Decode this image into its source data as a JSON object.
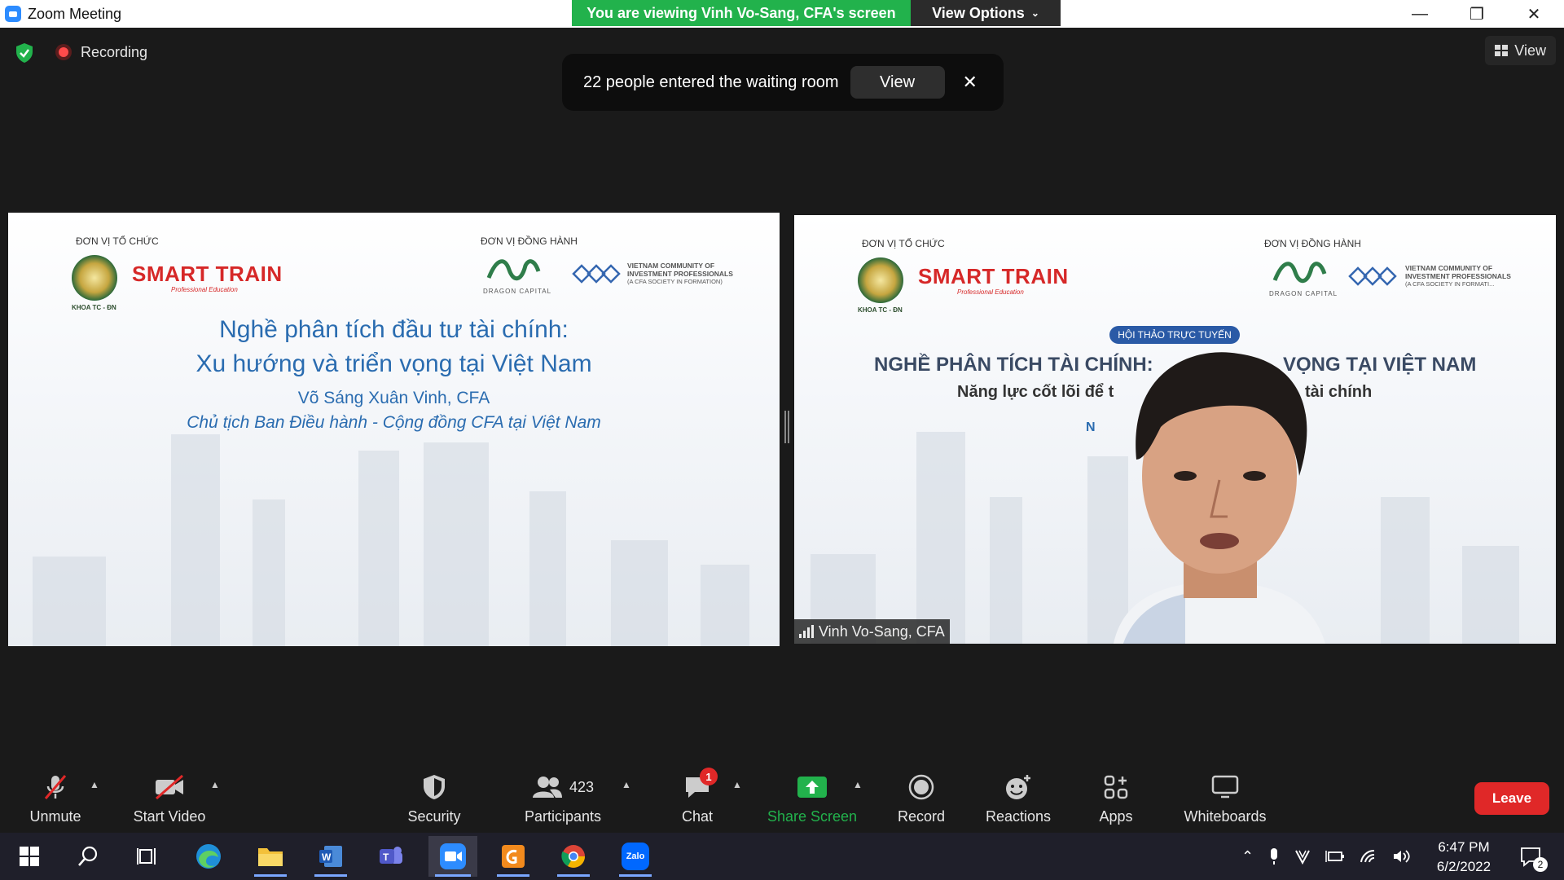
{
  "window": {
    "title": "Zoom Meeting",
    "viewing_banner": "You are viewing Vinh Vo-Sang, CFA's screen",
    "view_options": "View Options",
    "controls": {
      "minimize": "—",
      "restore": "❐",
      "close": "✕"
    }
  },
  "meeting_header": {
    "recording_label": "Recording",
    "view_button": "View"
  },
  "notification": {
    "message": "22 people entered the waiting room",
    "view_button": "View",
    "close": "✕"
  },
  "left_slide": {
    "organizer_label": "ĐƠN VỊ TỔ CHỨC",
    "companion_label": "ĐƠN VỊ ĐỒNG HÀNH",
    "seal_caption": "KHOA TC - ĐN",
    "smart_train": "SMART TRAIN",
    "smart_train_sub": "Professional Education",
    "dragon_caption": "DRAGON CAPITAL",
    "vc_lines": [
      "VIETNAM COMMUNITY OF",
      "INVESTMENT PROFESSIONALS",
      "(A CFA SOCIETY IN FORMATION)"
    ],
    "title_line1": "Nghề phân tích đầu tư tài chính:",
    "title_line2": "Xu hướng và triển vọng tại Việt Nam",
    "author": "Võ Sáng Xuân Vinh, CFA",
    "role": "Chủ tịch Ban Điều hành - Cộng đồng CFA tại Việt Nam"
  },
  "right_video": {
    "organizer_label": "ĐƠN VỊ TỔ CHỨC",
    "companion_label": "ĐƠN VỊ ĐỒNG HÀNH",
    "seal_caption": "KHOA TC - ĐN",
    "smart_train": "SMART TRAIN",
    "smart_train_sub": "Professional Education",
    "dragon_caption": "DRAGON CAPITAL",
    "vc_lines": [
      "VIETNAM COMMUNITY OF",
      "INVESTMENT PROFESSIONALS",
      "(A CFA SOCIETY IN FORMATI..."
    ],
    "badge": "HỘI THẢO TRỰC TUYẾN",
    "title_left": "NGHỀ PHÂN TÍCH TÀI CHÍNH: ",
    "title_right": " VỌNG TẠI VIỆT NAM",
    "sub_left": "Năng lực cốt lõi để t",
    "sub_right": " tài chính",
    "fragment": "N",
    "participant_name": "Vinh Vo-Sang, CFA"
  },
  "toolbar": {
    "unmute": "Unmute",
    "start_video": "Start Video",
    "security": "Security",
    "participants": "Participants",
    "participant_count": "423",
    "chat": "Chat",
    "chat_badge": "1",
    "share_screen": "Share Screen",
    "record": "Record",
    "reactions": "Reactions",
    "apps": "Apps",
    "whiteboards": "Whiteboards",
    "leave": "Leave",
    "accent_green": "#22B24C",
    "leave_red": "#E02828"
  },
  "taskbar": {
    "time": "6:47 PM",
    "date": "6/2/2022",
    "notification_count": "2",
    "icons": [
      "windows-start",
      "search",
      "task-view",
      "edge",
      "file-explorer",
      "word",
      "teams",
      "zoom",
      "foxit",
      "chrome",
      "zalo"
    ],
    "zalo_label": "Zalo"
  }
}
